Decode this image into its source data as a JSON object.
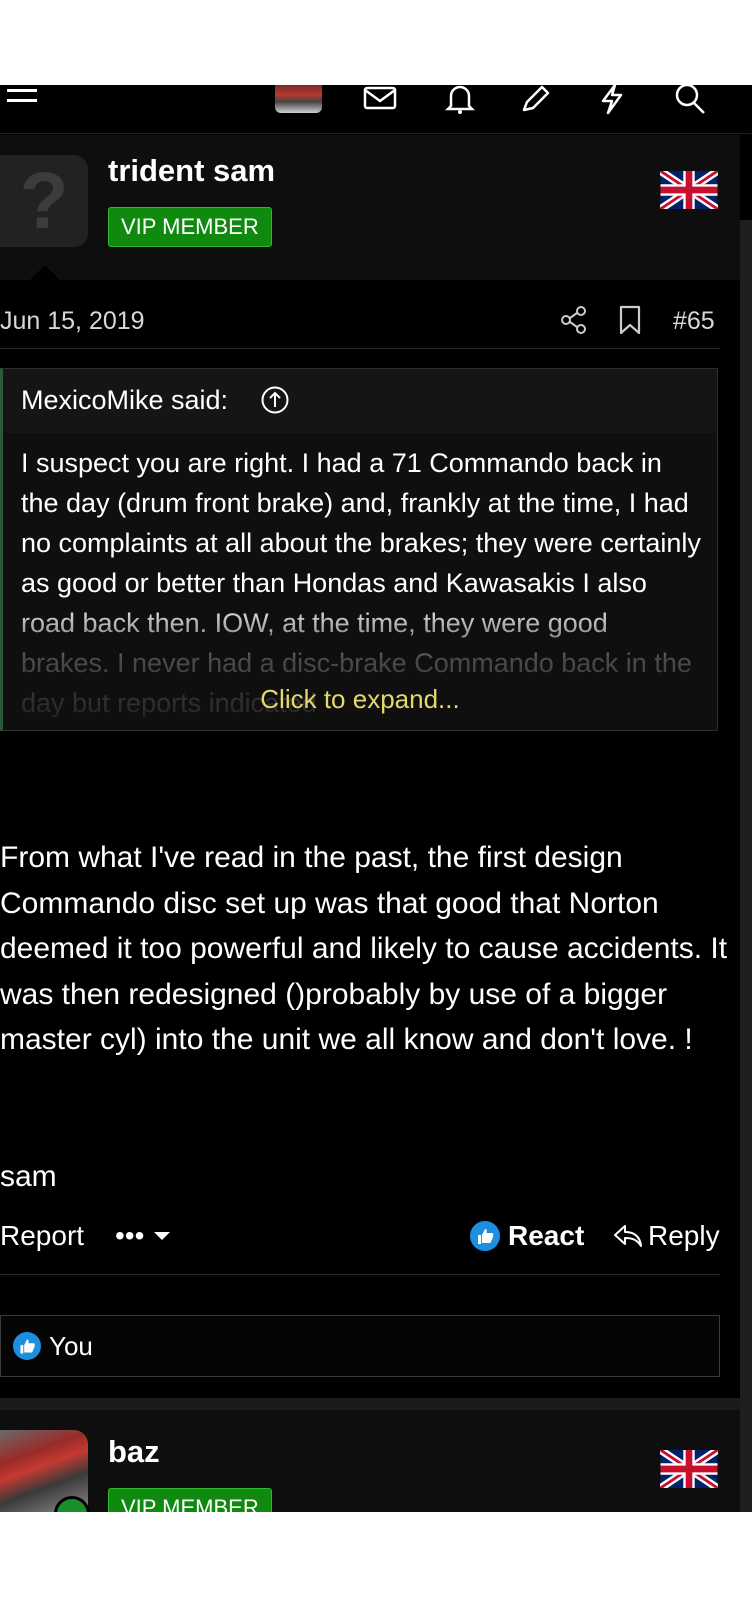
{
  "nav": {
    "icons": [
      "menu-icon",
      "user-avatar-thumbnail",
      "envelope-icon",
      "bell-icon",
      "pencil-icon",
      "lightning-icon",
      "search-icon"
    ]
  },
  "post": {
    "username": "trident sam",
    "badge": "VIP MEMBER",
    "flag": "uk-flag",
    "date": "Jun 15, 2019",
    "number": "#65",
    "quote": {
      "author": "MexicoMike said:",
      "text": "I suspect you are right. I had a 71 Commando back in the day (drum front brake) and, frankly at the time, I had no complaints at all about the brakes; they were certainly as good or better than Hondas and Kawasakis I also road back then. IOW, at the time, they were good brakes. I never had a disc-brake Commando back in the day but reports indicated",
      "expand_label": "Click to expand..."
    },
    "body": "From what I've read in the past, the first design Commando disc set up was that good that Norton deemed it too powerful and likely to cause accidents. It was then redesigned ()probably by use of a bigger master cyl) into the unit we all know and don't love. !",
    "signature": "sam",
    "actions": {
      "report": "Report",
      "more": "•••",
      "react": "React",
      "reply": "Reply"
    },
    "reactions_text": "You"
  },
  "next_post": {
    "username": "baz",
    "badge": "VIP MEMBER",
    "flag": "uk-flag"
  },
  "colors": {
    "background": "#000000",
    "badge_green": "#0f8a0f",
    "expand_yellow": "#e4d86a",
    "like_blue": "#1d8fe0"
  }
}
